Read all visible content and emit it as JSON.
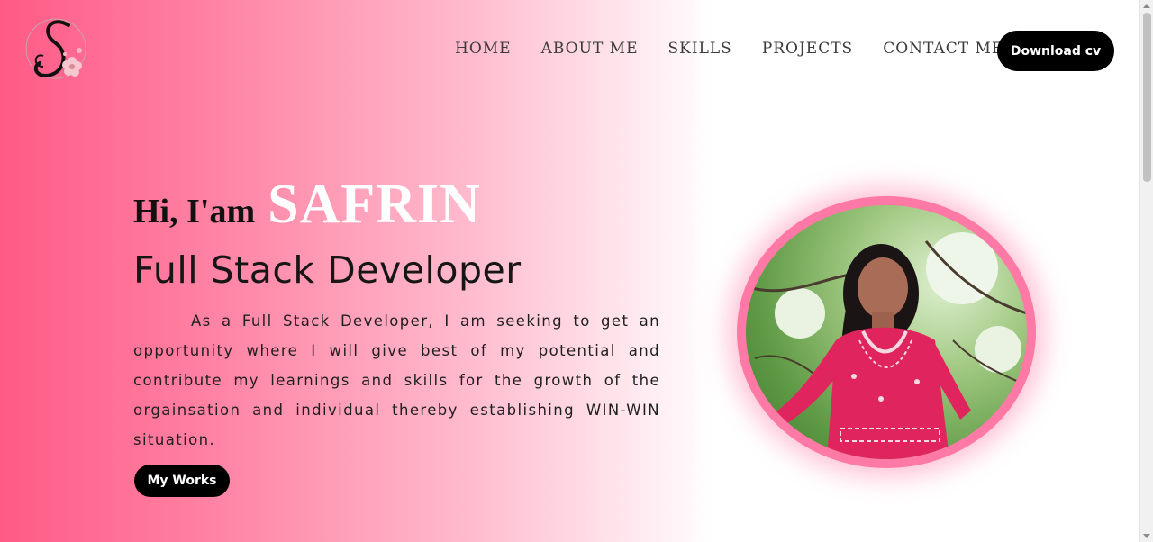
{
  "nav": {
    "items": [
      {
        "label": "HOME"
      },
      {
        "label": "ABOUT ME"
      },
      {
        "label": "SKILLS"
      },
      {
        "label": "PROJECTS"
      },
      {
        "label": "CONTACT ME"
      }
    ],
    "download_label": "Download cv"
  },
  "logo": {
    "letter": "S",
    "icon": "monogram-s-flower-icon"
  },
  "hero": {
    "greeting": "Hi, I'am",
    "name": "SAFRIN",
    "role": "Full Stack Developer",
    "description": "As a Full Stack Developer, I am seeking to get an opportunity where I will give best of my potential and contribute my learnings and skills for the growth of the orgainsation and individual thereby establishing WIN-WIN situation.",
    "works_label": "My Works"
  },
  "profile": {
    "icon": "profile-photo"
  },
  "colors": {
    "accent": "#ff5a86",
    "photo_ring": "#ff79a6",
    "button": "#000000"
  }
}
